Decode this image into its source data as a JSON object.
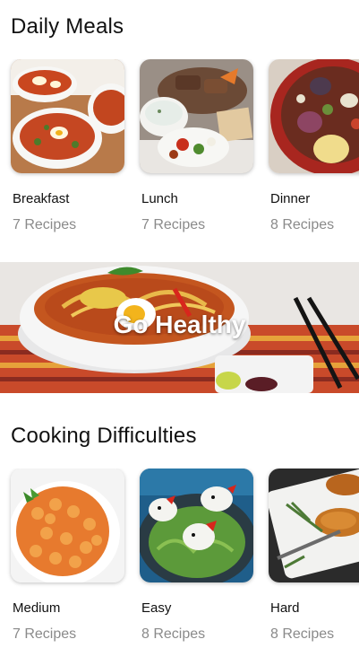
{
  "daily_meals": {
    "title": "Daily Meals",
    "items": [
      {
        "name": "Breakfast",
        "count": "7 Recipes"
      },
      {
        "name": "Lunch",
        "count": "7 Recipes"
      },
      {
        "name": "Dinner",
        "count": "8 Recipes"
      }
    ]
  },
  "banner": {
    "label": "Go Healthy"
  },
  "cooking_difficulties": {
    "title": "Cooking Difficulties",
    "items": [
      {
        "name": "Medium",
        "count": "7 Recipes"
      },
      {
        "name": "Easy",
        "count": "8 Recipes"
      },
      {
        "name": "Hard",
        "count": "8 Recipes"
      }
    ]
  }
}
